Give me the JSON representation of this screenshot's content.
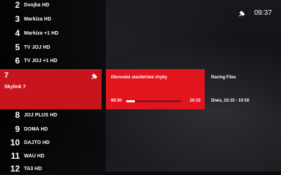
{
  "status_bar": {
    "time": "09:37",
    "icon": "satellite-icon"
  },
  "channels_above": [
    {
      "number": "2",
      "name": "Dvojka HD"
    },
    {
      "number": "3",
      "name": "Markíza HD"
    },
    {
      "number": "4",
      "name": "Markíza +1 HD"
    },
    {
      "number": "5",
      "name": "TV JOJ HD"
    },
    {
      "number": "6",
      "name": "TV JOJ +1 HD"
    }
  ],
  "selected_channel": {
    "number": "7",
    "name": "Skylink 7",
    "icon": "satellite-icon"
  },
  "channels_below": [
    {
      "number": "8",
      "name": "JOJ PLUS HD"
    },
    {
      "number": "9",
      "name": "DOMA HD"
    },
    {
      "number": "10",
      "name": "DAJTO HD"
    },
    {
      "number": "11",
      "name": "WAU HD"
    },
    {
      "number": "12",
      "name": "TA3 HD"
    }
  ],
  "current_program": {
    "title": "Obrovské staviteľské chyby",
    "start": "09:30",
    "end": "10:15",
    "progress": 0.16
  },
  "next_program": {
    "title": "Racing Files",
    "time": "Dnes, 10:15 - 10:50"
  },
  "colors": {
    "accent": "#e2151f",
    "selected": "#c8141c"
  }
}
